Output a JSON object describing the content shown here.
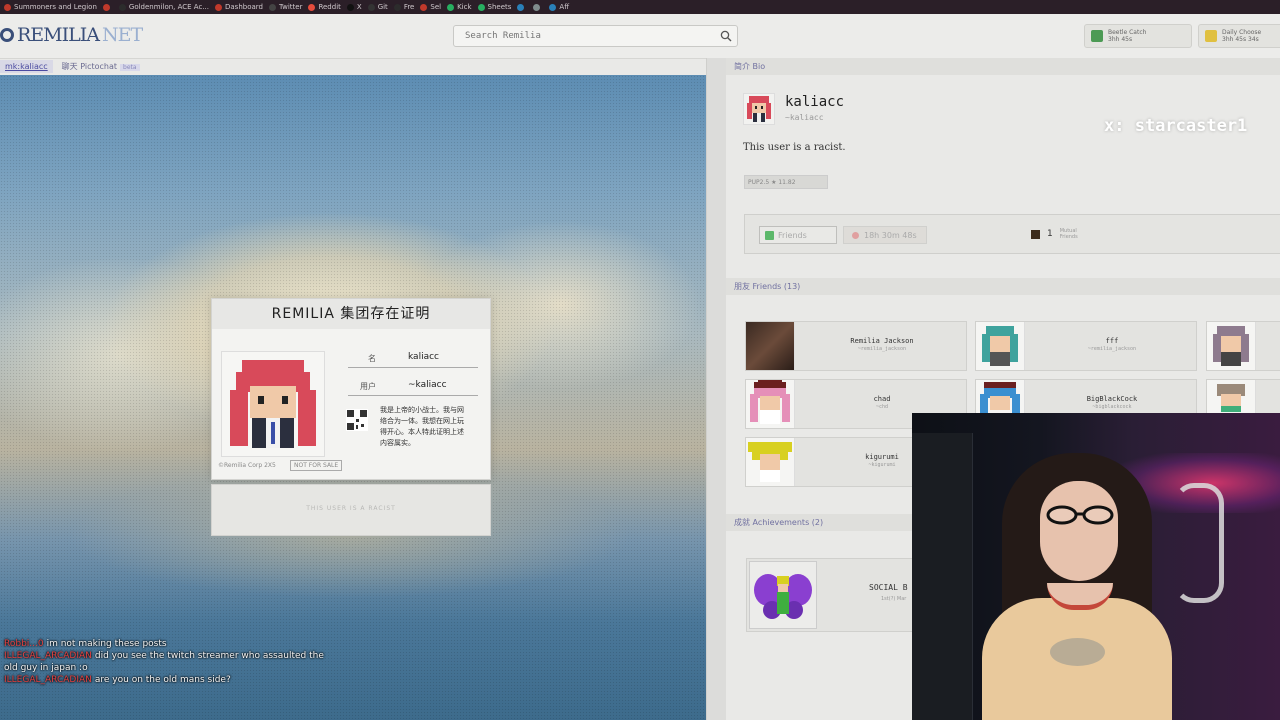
{
  "bookmarks": [
    {
      "label": "Summoners and Legion",
      "color": "#c0392b"
    },
    {
      "label": "",
      "color": "#c0392b"
    },
    {
      "label": "Goldenmilon, ACE Ac...",
      "color": "#2c2c2c"
    },
    {
      "label": "Dashboard",
      "color": "#c0392b"
    },
    {
      "label": "Twitter",
      "color": "#444"
    },
    {
      "label": "Reddit",
      "color": "#e74c3c"
    },
    {
      "label": "X",
      "color": "#111"
    },
    {
      "label": "Git",
      "color": "#333"
    },
    {
      "label": "Fre",
      "color": "#2c2c2c"
    },
    {
      "label": "Sel",
      "color": "#c0392b"
    },
    {
      "label": "Kick",
      "color": "#27ae60"
    },
    {
      "label": "Sheets",
      "color": "#27ae60"
    },
    {
      "label": "",
      "color": "#2980b9"
    },
    {
      "label": "",
      "color": "#7f8c8d"
    },
    {
      "label": "Aff",
      "color": "#2980b9"
    }
  ],
  "header": {
    "logo_main": "REMILIA",
    "logo_suffix": "NET",
    "search_placeholder": "Search Remilia",
    "widgets": [
      {
        "title": "Beetle Catch",
        "sub": "3hh 45s",
        "icon": "beetle-icon",
        "color": "#4c9a54"
      },
      {
        "title": "Daily Choose",
        "sub": "3hh 45s 34s",
        "icon": "gift-icon",
        "color": "#e0c040"
      }
    ]
  },
  "tabs": [
    {
      "label": "mk:kaliacc",
      "active": true
    },
    {
      "label": "聊天 Pictochat",
      "badge": "beta",
      "active": false
    }
  ],
  "id_card": {
    "title": "REMILIA 集团存在证明",
    "name_label": "名",
    "name_value": "kaliacc",
    "user_label": "用户",
    "user_value": "~kaliacc",
    "description": "我是上帝的小战士。我与网络合为一体。我想在网上玩得开心。本人特此证明上述内容属实。",
    "copyright": "©Remilia Corp 2X5",
    "not_for_sale": "NOT FOR SALE",
    "bottom_text": "THIS USER IS A RACIST"
  },
  "chat": [
    {
      "user": "Robbi...0",
      "text": "im not making these posts"
    },
    {
      "user": "ILLEGAL_ARCADIAN",
      "text": "did you see the twitch streamer who assaulted the old guy in japan :o"
    },
    {
      "user": "ILLEGAL_ARCADIAN",
      "text": "are you on the old mans side?"
    }
  ],
  "bio": {
    "section_title": "简介 Bio",
    "name": "kaliacc",
    "handle": "~kaliacc",
    "text": "This user is a racist.",
    "stats": "PUP2.5 ★ 11.82",
    "watermark": "x: starcaster1",
    "friends_button": "Friends",
    "timer": "18h 30m 48s",
    "mutual_count": "1",
    "mutual_label": "Mutual Friends"
  },
  "friends_section": {
    "title": "朋友 Friends (13)",
    "items": [
      {
        "name": "Remilia Jackson",
        "handle": "~remilia_jackson"
      },
      {
        "name": "fff",
        "handle": "~remilia_jackson"
      },
      {
        "name": "chad",
        "handle": "~chd"
      },
      {
        "name": "BigBlackCock",
        "handle": "~bigblackcock"
      },
      {
        "name": "kigurumi",
        "handle": "~kigurumi"
      }
    ]
  },
  "achievements": {
    "title": "成就 Achievements (2)",
    "item_name": "SOCIAL B",
    "item_sub": "1st(?) Mar"
  }
}
